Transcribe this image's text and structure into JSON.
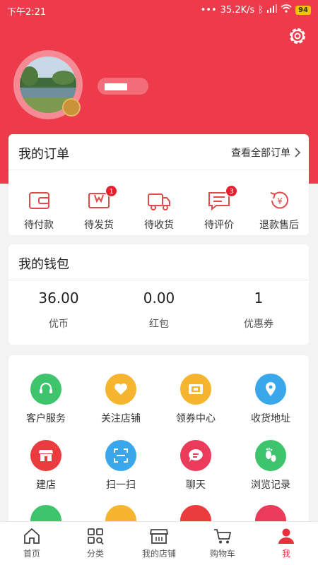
{
  "status_bar": {
    "time": "下午2:21",
    "network_speed": "35.2K/s",
    "battery": "94"
  },
  "colors": {
    "accent": "#ee3b4c",
    "badge": "#e8202e"
  },
  "header": {
    "settings_icon": "gear-icon"
  },
  "orders": {
    "title": "我的订单",
    "view_all": "查看全部订单",
    "items": [
      {
        "label": "待付款",
        "icon": "wallet-icon",
        "badge": ""
      },
      {
        "label": "待发货",
        "icon": "package-icon",
        "badge": "1"
      },
      {
        "label": "待收货",
        "icon": "truck-icon",
        "badge": ""
      },
      {
        "label": "待评价",
        "icon": "comment-icon",
        "badge": "3"
      },
      {
        "label": "退款售后",
        "icon": "refund-icon",
        "badge": ""
      }
    ]
  },
  "wallet": {
    "title": "我的钱包",
    "items": [
      {
        "value": "36.00",
        "label": "优币"
      },
      {
        "value": "0.00",
        "label": "红包"
      },
      {
        "value": "1",
        "label": "优惠券"
      }
    ]
  },
  "services": {
    "items": [
      {
        "label": "客户服务",
        "icon": "headset-icon",
        "color": "#3ec46d"
      },
      {
        "label": "关注店铺",
        "icon": "heart-icon",
        "color": "#f6b52e"
      },
      {
        "label": "领券中心",
        "icon": "coupon-icon",
        "color": "#f6b52e"
      },
      {
        "label": "收货地址",
        "icon": "location-icon",
        "color": "#3aa7ea"
      },
      {
        "label": "建店",
        "icon": "store-icon",
        "color": "#ea3b3f"
      },
      {
        "label": "扫一扫",
        "icon": "scan-icon",
        "color": "#3aa7ea"
      },
      {
        "label": "聊天",
        "icon": "chat-icon",
        "color": "#ea3b5a"
      },
      {
        "label": "浏览记录",
        "icon": "footprint-icon",
        "color": "#3ec46d"
      }
    ]
  },
  "tabbar": {
    "items": [
      {
        "label": "首页",
        "icon": "home-icon"
      },
      {
        "label": "分类",
        "icon": "category-icon"
      },
      {
        "label": "我的店铺",
        "icon": "shop-icon"
      },
      {
        "label": "购物车",
        "icon": "cart-icon"
      },
      {
        "label": "我",
        "icon": "user-icon"
      }
    ]
  }
}
